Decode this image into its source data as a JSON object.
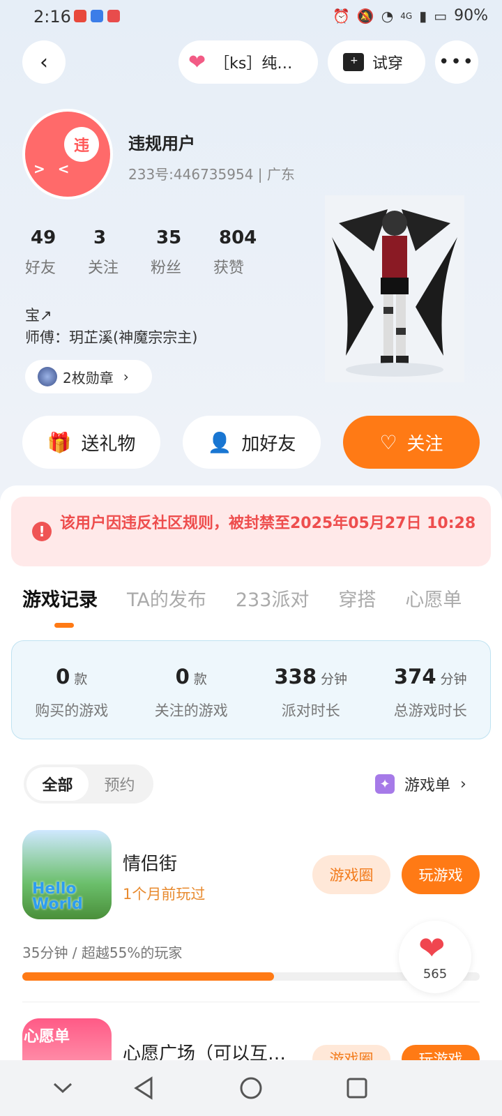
{
  "status": {
    "time": "2:16",
    "battery": "90%",
    "network": "4G"
  },
  "topbar": {
    "song": "［ks］纯…",
    "try_on": "试穿"
  },
  "profile": {
    "username": "违规用户",
    "avatar_badge": "违",
    "id_line": "233号:446735954 | 广东",
    "stats": [
      {
        "value": "49",
        "label": "好友"
      },
      {
        "value": "3",
        "label": "关注"
      },
      {
        "value": "35",
        "label": "粉丝"
      },
      {
        "value": "804",
        "label": "获赞"
      }
    ],
    "bio_line1": "宝↗",
    "bio_line2": "师傅：玥芷溪(神魔宗宗主)",
    "medals": "2枚勋章"
  },
  "actions": {
    "gift": "送礼物",
    "add_friend": "加好友",
    "follow": "关注"
  },
  "ban_notice": "该用户因违反社区规则，被封禁至2025年05月27日 10:28",
  "tabs": [
    "游戏记录",
    "TA的发布",
    "233派对",
    "穿搭",
    "心愿单"
  ],
  "game_stats": [
    {
      "value": "0",
      "unit": "款",
      "label": "购买的游戏"
    },
    {
      "value": "0",
      "unit": "款",
      "label": "关注的游戏"
    },
    {
      "value": "338",
      "unit": "分钟",
      "label": "派对时长"
    },
    {
      "value": "374",
      "unit": "分钟",
      "label": "总游戏时长"
    }
  ],
  "filters": {
    "all": "全部",
    "reserve": "预约"
  },
  "game_list_link": "游戏单",
  "games": [
    {
      "title": "情侣街",
      "subtitle": "1个月前玩过",
      "icon_text": "Hello World",
      "circle_btn": "游戏圈",
      "play_btn": "玩游戏",
      "progress_text": "35分钟 / 超越55%的玩家",
      "progress_fraction": 0.55
    },
    {
      "title": "心愿广场（可以互…",
      "icon_text": "心愿单",
      "circle_btn": "游戏圈",
      "play_btn": "玩游戏"
    }
  ],
  "like_count": "565",
  "colors": {
    "accent": "#ff7a15",
    "ban_bg": "#ffe9e9",
    "ban_text": "#ee4d4d",
    "stats_bg": "#eef7fc"
  }
}
